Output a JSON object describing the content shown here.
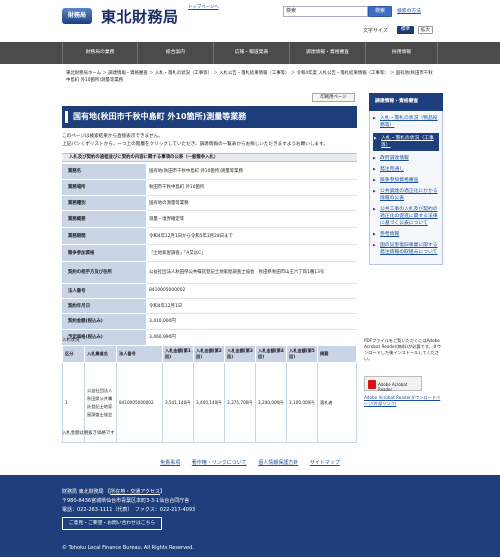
{
  "header": {
    "logo_mark": "財務局",
    "site_name": "東北財務局",
    "top_link": "トップページへ",
    "search_value": "検索",
    "search_button": "検索",
    "search_help": "検索の方法",
    "text_size_label": "文字サイズ",
    "text_size_standard": "標準",
    "text_size_large": "拡大"
  },
  "nav": [
    "財務局の業務",
    "総合案内",
    "広報・報道発表",
    "調達情報・資格審査",
    "採用情報"
  ],
  "breadcrumb": "東北財務局ホーム ＞ 調達情報・資格審査 ＞ 入札・落札の状況（工事等） ＞ 入札公告・落札結果情報（工事等） ＞ 令和4年度 入札公告・落札結果情報（工事等） ＞ 国有地(秋田市千秋中島町 外10箇所)測量等業務",
  "main": {
    "print_button": "印刷用ページ",
    "title": "国有地(秋田市千秋中島町 外10箇所)測量等業務",
    "intro_line1": "このページは検索結果から直接表示できません。",
    "intro_line2": "上記パンくずリストから、一つ上の階層をクリックしていただき、調達情報の一覧表からお探しいただきますようお願いします。",
    "section_heading": "入札及び契約の過程並びに契約の内容に関する事項の公表（一般競争入札）",
    "info_rows": [
      {
        "label": "業務名",
        "value": "国有地(秋田市千秋中島町 外10箇所)測量等業務"
      },
      {
        "label": "業務場所",
        "value": "秋田市千秋中島町 外10箇所"
      },
      {
        "label": "業務種別",
        "value": "国有地の測量等業務"
      },
      {
        "label": "業務概要",
        "value": "測量・境界確定等"
      },
      {
        "label": "業務期間",
        "value": "令和4年12月1日から令和5年3月28日まで"
      },
      {
        "label": "競争参加資格",
        "value": "「土地家屋調査」「A又はC」"
      },
      {
        "label": "契約の相手方及び住所",
        "value": "公益社団法人秋田県公共嘱託登記土地家屋調査士協会　秋田県秋田市山王六丁目1番13号"
      },
      {
        "label": "法人番号",
        "value": "8410005000002"
      },
      {
        "label": "契約年月日",
        "value": "令和4年12月1日"
      },
      {
        "label": "契約金額(税込み)",
        "value": "3,410,000円"
      },
      {
        "label": "予定価格(税込み)",
        "value": "3,460,990円"
      }
    ],
    "result_label": "入札状況",
    "result_headers": [
      "区分",
      "入札業者名",
      "法人番号",
      "入札金額(第1回)",
      "入札金額(第2回)",
      "入札金額(第3回)",
      "入札金額(第4回)",
      "入札金額(第5回)",
      "摘要"
    ],
    "result_row": [
      "1",
      "公益社団法人秋田県公共嘱託登記土地家屋調査士協会",
      "8410005000002",
      "3,541,140円",
      "3,440,140円",
      "3,375,700円",
      "3,200,000円",
      "3,100,000円",
      "落札者"
    ],
    "footnote": "入札金額は税抜き価格です"
  },
  "sidebar": {
    "heading": "調達情報・資格審査",
    "items": [
      "入札・落札の状況（物品役務等）",
      "入札・落札の状況（工事等）",
      "政府調達情報",
      "発注見通し",
      "競争参加資格審査",
      "公共調達の適正化にかかる情報の公表",
      "公共工事の入札及び契約の適正化の促進に関する法律に基づく公表について",
      "参考情報",
      "国の災害復旧事業に関する発注情報の取組みについて"
    ],
    "pdf_note": "PDFファイルをご覧いただくにはAdobe Acrobat Reader(無料)が必要です。ダウンロードした後インストールしてください。",
    "pdf_badge": "Adobe Acrobat Reader",
    "pdf_link": "Adobe Acrobat Readerダウンロードページ(外部リンク)"
  },
  "footer": {
    "links": [
      "免責事項",
      "著作権・リンクについて",
      "個人情報保護方針",
      "サイトマップ"
    ],
    "org": "財務局 東北財務局",
    "access": "所在地・交通アクセス",
    "address": "〒980-8436宮城県仙台市青葉区本町3-3-1仙台合同庁舎",
    "phone": "電話：022-263-1111（代表）　ファクス：022-217-4093",
    "contact_button": "ご意見・ご要望・お問い合わせはこちら",
    "copyright": "© Tohoku Local Finance Bureau. All Rights Reserved."
  }
}
